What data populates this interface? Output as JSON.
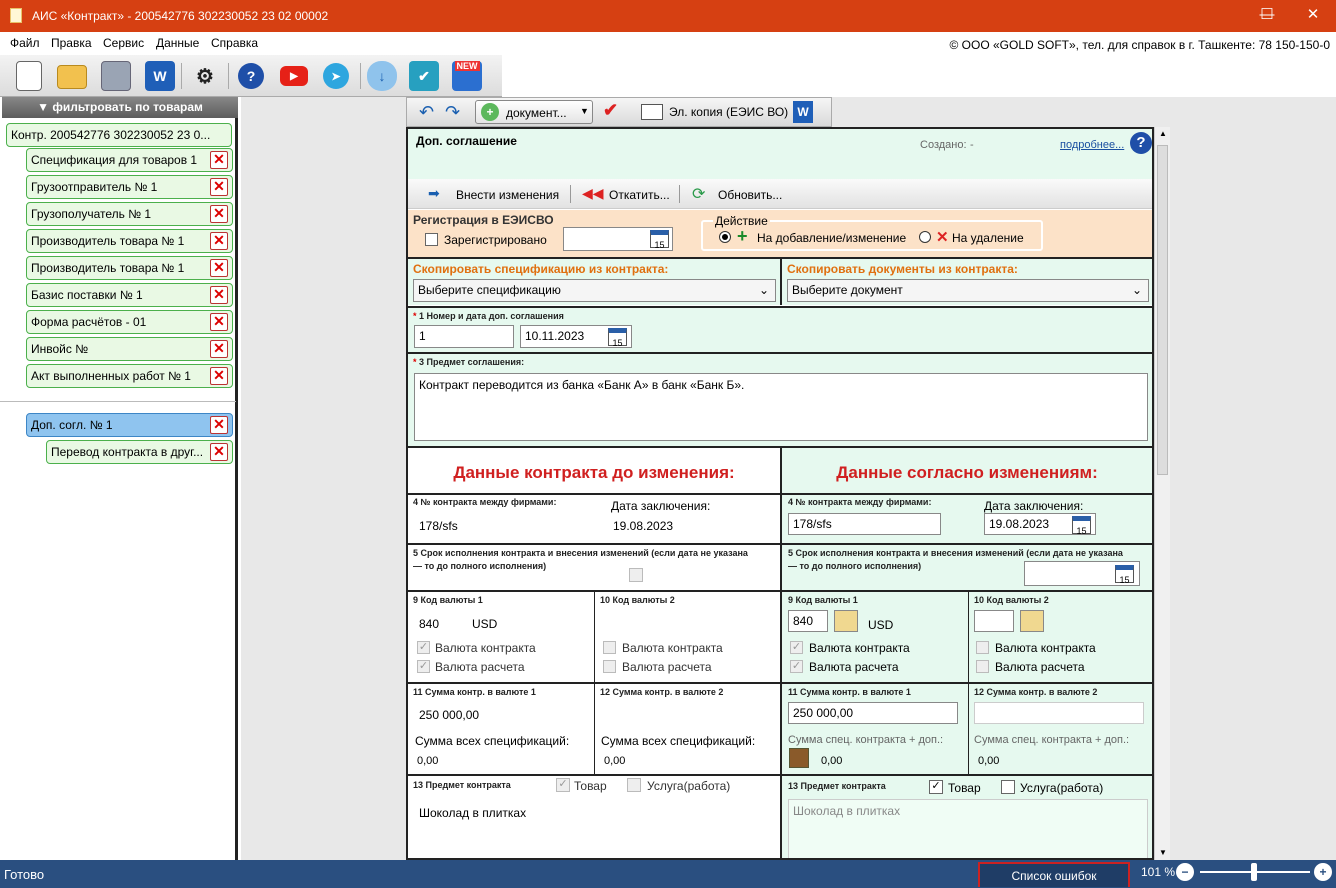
{
  "window": {
    "title": "АИС «Контракт» - 200542776 302230052 23 02 00002",
    "min": "—",
    "max": "☐",
    "close": "✕"
  },
  "menu": [
    "Файл",
    "Правка",
    "Сервис",
    "Данные",
    "Справка"
  ],
  "copyright": "© ООО «GOLD SOFT», тел. для справок в г. Ташкенте: 78 150-150-0",
  "toolbar": {
    "new_label": "NEW",
    "word": "W"
  },
  "sidebar": {
    "filter": "фильтровать по товарам",
    "root": "Контр. 200542776 302230052 23 0...",
    "items": [
      "Спецификация для товаров 1",
      "Грузоотправитель № 1",
      "Грузополучатель № 1",
      "Производитель товара № 1",
      "Производитель товара № 1",
      "Базис поставки № 1",
      "Форма расчётов - 01",
      "Инвойс №",
      "Акт выполненных работ № 1"
    ],
    "dop": "Доп. согл. № 1",
    "dop_child": "Перевод контракта в друг..."
  },
  "doc_toolbar": {
    "document": "документ...",
    "el_copy": "Эл. копия (ЕЭИС ВО)"
  },
  "doc": {
    "title": "Доп. соглашение",
    "created_label": "Создано:",
    "created_value": "-",
    "more": "подробнее...",
    "actions": {
      "apply": "Внести изменения",
      "rollback": "Откатить...",
      "refresh": "Обновить..."
    },
    "reg": {
      "title": "Регистрация в ЕЭИСВО",
      "registered": "Зарегистрировано",
      "action_title": "Действие",
      "opt_add": "На добавление/изменение",
      "opt_del": "На удаление"
    },
    "copy_spec": {
      "label": "Скопировать спецификацию из контракта:",
      "value": "Выберите спецификацию"
    },
    "copy_docs": {
      "label": "Скопировать документы из контракта:",
      "value": "Выберите документ"
    },
    "num_date": {
      "label": "1 Номер и дата доп. соглашения",
      "number": "1",
      "date": "10.11.2023"
    },
    "subject": {
      "label": "3 Предмет соглашения:",
      "text": "Контракт переводится из банка «Банк А» в банк «Банк Б»."
    },
    "before_title": "Данные контракта до изменения:",
    "after_title": "Данные согласно изменениям:",
    "f4_label": "4 № контракта между фирмами:",
    "f4_date_label": "Дата заключения:",
    "before": {
      "contract_no": "178/sfs",
      "date": "19.08.2023",
      "cur1_code": "840",
      "cur1_name": "USD",
      "sum1": "250 000,00",
      "spec_label": "Сумма всех спецификаций:",
      "spec1": "0,00",
      "spec2": "0,00",
      "subject": "Шоколад в плитках"
    },
    "after": {
      "contract_no": "178/sfs",
      "date": "19.08.2023",
      "cur1_code": "840",
      "cur1_name": "USD",
      "sum1": "250 000,00",
      "spec_label": "Сумма спец. контракта + доп.:",
      "spec1": "0,00",
      "spec2": "0,00",
      "subject": "Шоколад в плитках"
    },
    "f5_label": "5 Срок исполнения контракта и внесения изменений (если дата не указана — то до полного исполнения)",
    "f9_label": "9 Код валюты 1",
    "f10_label": "10 Код валюты 2",
    "cb_contract": "Валюта контракта",
    "cb_payment": "Валюта расчета",
    "f11_label": "11 Сумма контр. в валюте 1",
    "f12_label": "12 Сумма контр. в валюте 2",
    "f13_label": "13 Предмет контракта",
    "goods": "Товар",
    "service": "Услуга(работа)"
  },
  "status": {
    "ready": "Готово",
    "errors": "Список ошибок",
    "zoom": "101 %"
  }
}
